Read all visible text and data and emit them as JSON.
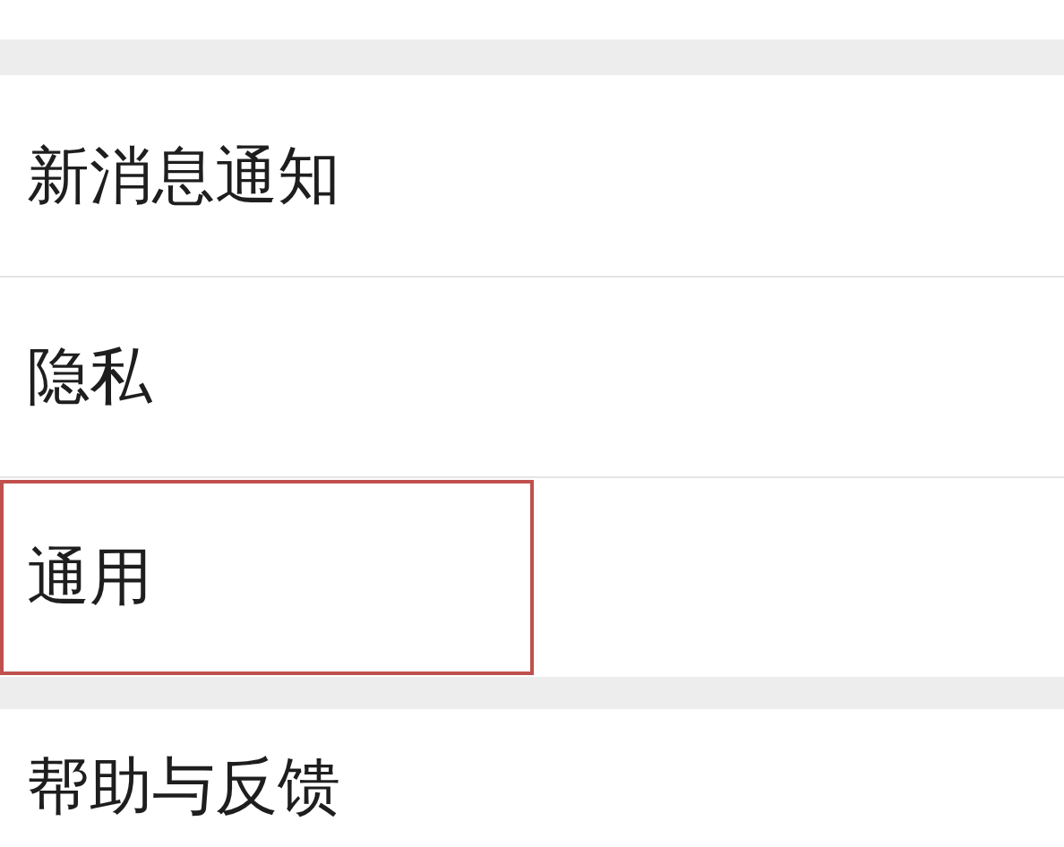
{
  "groups": [
    {
      "items": [
        {
          "label": "新消息通知",
          "highlighted": false
        },
        {
          "label": "隐私",
          "highlighted": false
        },
        {
          "label": "通用",
          "highlighted": true
        }
      ]
    },
    {
      "items": [
        {
          "label": "帮助与反馈",
          "highlighted": false
        }
      ]
    }
  ]
}
